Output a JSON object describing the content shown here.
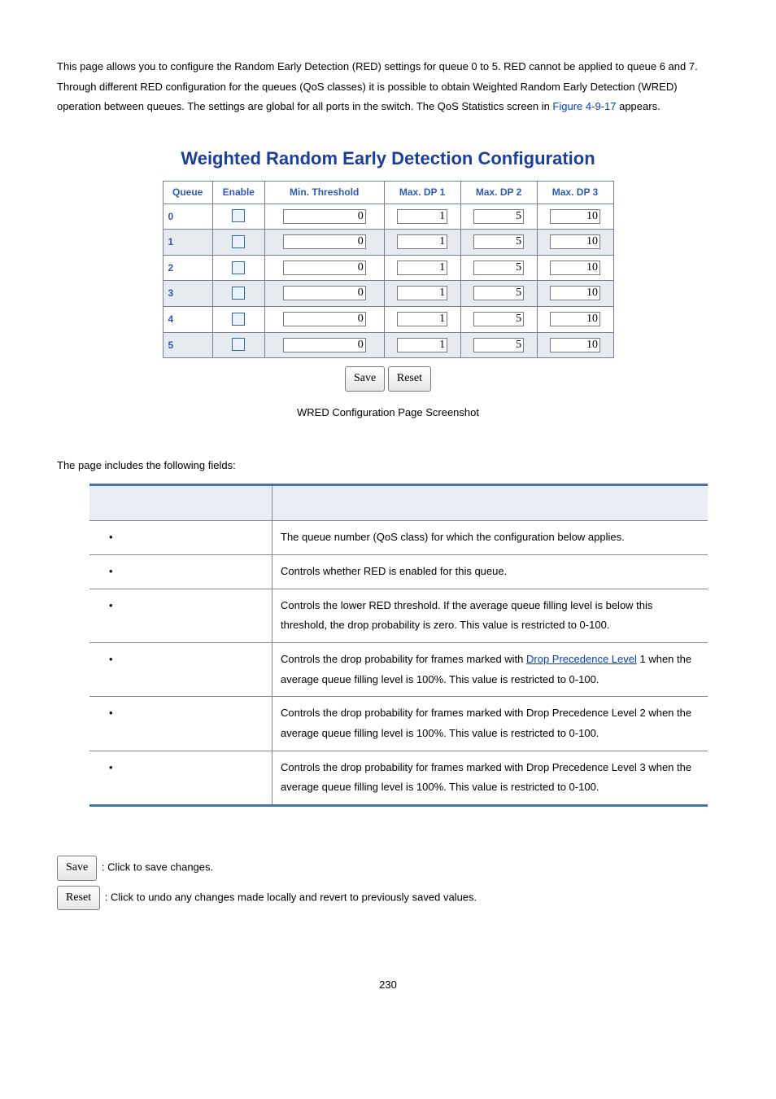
{
  "intro": {
    "text_before_link": "This page allows you to configure the Random Early Detection (RED) settings for queue 0 to 5. RED cannot be applied to queue 6 and 7. Through different RED configuration for the queues (QoS classes) it is possible to obtain Weighted Random Early Detection (WRED) operation between queues. The settings are global for all ports in the switch. The QoS Statistics screen in ",
    "link": "Figure 4-9-17",
    "text_after_link": " appears."
  },
  "screenshot": {
    "title": "Weighted Random Early Detection Configuration",
    "headers": [
      "Queue",
      "Enable",
      "Min. Threshold",
      "Max. DP 1",
      "Max. DP 2",
      "Max. DP 3"
    ],
    "rows": [
      {
        "queue": "0",
        "min": "0",
        "dp1": "1",
        "dp2": "5",
        "dp3": "10"
      },
      {
        "queue": "1",
        "min": "0",
        "dp1": "1",
        "dp2": "5",
        "dp3": "10"
      },
      {
        "queue": "2",
        "min": "0",
        "dp1": "1",
        "dp2": "5",
        "dp3": "10"
      },
      {
        "queue": "3",
        "min": "0",
        "dp1": "1",
        "dp2": "5",
        "dp3": "10"
      },
      {
        "queue": "4",
        "min": "0",
        "dp1": "1",
        "dp2": "5",
        "dp3": "10"
      },
      {
        "queue": "5",
        "min": "0",
        "dp1": "1",
        "dp2": "5",
        "dp3": "10"
      }
    ],
    "save": "Save",
    "reset": "Reset"
  },
  "caption": "WRED Configuration Page Screenshot",
  "fields_intro": "The page includes the following fields:",
  "fields": [
    {
      "desc": "The queue number (QoS class) for which the configuration below applies."
    },
    {
      "desc": "Controls whether RED is enabled for this queue."
    },
    {
      "desc": "Controls the lower RED threshold. If the average queue filling level is below this threshold, the drop probability is zero. This value is restricted to 0-100."
    },
    {
      "desc_pre": "Controls the drop probability for frames marked with ",
      "desc_link": "Drop Precedence Level",
      "desc_post": " 1 when the average queue filling level is 100%. This value is restricted to 0-100."
    },
    {
      "desc": "Controls the drop probability for frames marked with Drop Precedence Level 2 when the average queue filling level is 100%. This value is restricted to 0-100."
    },
    {
      "desc": "Controls the drop probability for frames marked with Drop Precedence Level 3 when the average queue filling level is 100%. This value is restricted to 0-100."
    }
  ],
  "buttons": {
    "save": "Save",
    "save_desc": ": Click to save changes.",
    "reset": "Reset",
    "reset_desc": ": Click to undo any changes made locally and revert to previously saved values."
  },
  "page_number": "230"
}
